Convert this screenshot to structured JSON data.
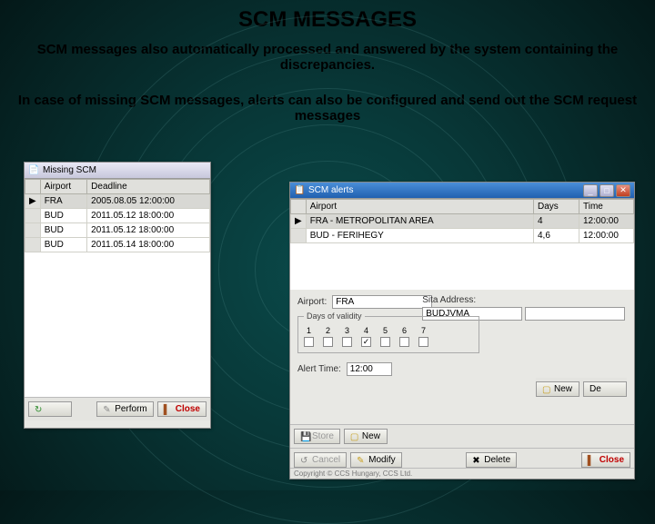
{
  "title": "SCM MESSAGES",
  "sub1": "SCM messages also automatically processed and answered by the system containing the discrepancies.",
  "sub2": "In case of missing SCM messages, alerts can also be configured and send out the SCM request messages",
  "win1": {
    "title": "Missing SCM",
    "cols": [
      "",
      "Airport",
      "Deadline"
    ],
    "rows": [
      [
        "▶",
        "FRA",
        "2005.08.05 12:00:00"
      ],
      [
        "",
        "BUD",
        "2011.05.12 18:00:00"
      ],
      [
        "",
        "BUD",
        "2011.05.12 18:00:00"
      ],
      [
        "",
        "BUD",
        "2011.05.14 18:00:00"
      ]
    ],
    "btn_perform": "Perform",
    "btn_close": "Close"
  },
  "win2": {
    "title": "SCM alerts",
    "cols": [
      "",
      "Airport",
      "Days",
      "Time"
    ],
    "rows": [
      [
        "▶",
        "FRA - METROPOLITAN AREA",
        "4",
        "12:00:00"
      ],
      [
        "",
        "BUD - FERIHEGY",
        "4,6",
        "12:00:00"
      ]
    ],
    "form": {
      "airport_lbl": "Airport:",
      "airport_val": "FRA",
      "sita_lbl": "Sita Address:",
      "sita_val": "BUDJVMA",
      "dov_lbl": "Days of validity",
      "days": [
        "1",
        "2",
        "3",
        "4",
        "5",
        "6",
        "7"
      ],
      "checked": [
        false,
        false,
        false,
        true,
        false,
        false,
        false
      ],
      "alert_lbl": "Alert Time:",
      "alert_val": "12:00"
    },
    "btns": {
      "store": "Store",
      "new": "New",
      "de": "De",
      "cancel": "Cancel",
      "modify": "Modify",
      "delete": "Delete",
      "close": "Close"
    },
    "copyright": "Copyright © CCS Hungary, CCS Ltd."
  }
}
